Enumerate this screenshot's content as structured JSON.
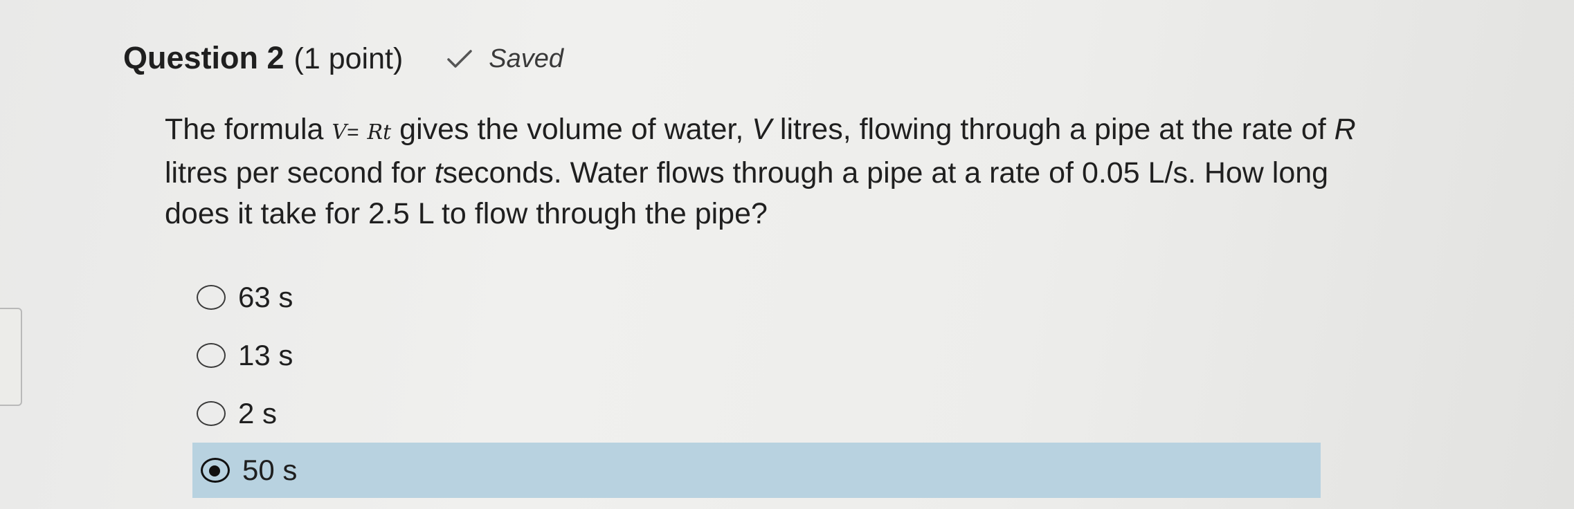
{
  "question": {
    "title": "Question 2",
    "points": "(1 point)",
    "status": "Saved",
    "status_icon": "check-icon",
    "body": {
      "intro": "The formula",
      "formula_v": "V",
      "formula_eq": "=",
      "formula_rt": "Rt",
      "part1": "gives the volume of water,",
      "var_v": "V",
      "part2": "litres, flowing through a pipe at the rate of",
      "var_r": "R",
      "part3": "litres per second for",
      "var_t": "t",
      "part4": "seconds. Water flows through a pipe at a rate of 0.05 L/s. How long does it take for 2.5 L to flow through the pipe?"
    },
    "options": [
      {
        "label": "63 s",
        "selected": false
      },
      {
        "label": "13 s",
        "selected": false
      },
      {
        "label": "2 s",
        "selected": false
      },
      {
        "label": "50 s",
        "selected": true
      }
    ]
  },
  "colors": {
    "selected_background": "#b8d2e0",
    "text": "#1f1f1f"
  }
}
